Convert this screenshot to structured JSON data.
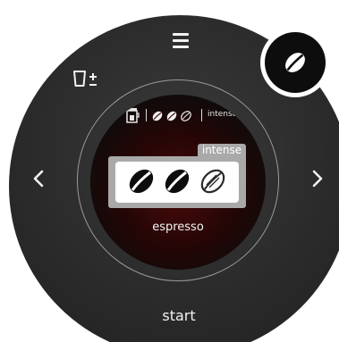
{
  "controls": {
    "menu_icon": "menu-icon",
    "cup_adjust_icon": "cup-plus-minus-icon",
    "prev_icon": "chevron-left-icon",
    "next_icon": "chevron-right-icon",
    "start_label": "start",
    "bean_badge_icon": "coffee-bean-icon"
  },
  "display": {
    "top_bar": {
      "cup_icon": "cup-icon",
      "mini_beans": [
        "bean-filled",
        "bean-filled",
        "bean-outline"
      ],
      "intensity_text": "intense"
    },
    "intensity_card": {
      "tab_label": "intense",
      "level": 2,
      "max_level": 3
    },
    "beverage": "espresso"
  },
  "colors": {
    "dial": "#2b2b2b",
    "accent_red": "#4a0a0a",
    "card_gray": "#a9a9a9",
    "text_light": "#f2f2f2"
  }
}
